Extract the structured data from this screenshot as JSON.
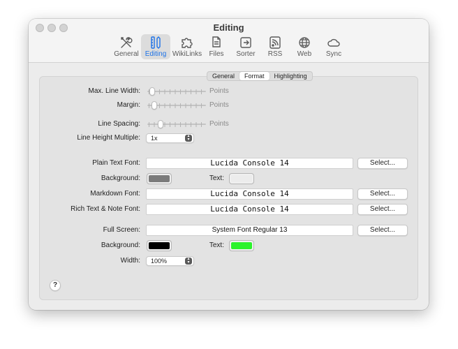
{
  "window": {
    "title": "Editing"
  },
  "toolbar": {
    "items": [
      {
        "label": "General",
        "icon": "tools-icon",
        "active": false
      },
      {
        "label": "Editing",
        "icon": "pencil-ruler-icon",
        "active": true
      },
      {
        "label": "WikiLinks",
        "icon": "puzzle-icon",
        "active": false
      },
      {
        "label": "Files",
        "icon": "files-icon",
        "active": false
      },
      {
        "label": "Sorter",
        "icon": "sorter-icon",
        "active": false
      },
      {
        "label": "RSS",
        "icon": "rss-icon",
        "active": false
      },
      {
        "label": "Web",
        "icon": "globe-icon",
        "active": false
      },
      {
        "label": "Sync",
        "icon": "cloud-icon",
        "active": false
      }
    ]
  },
  "tabs": [
    {
      "label": "General",
      "selected": false
    },
    {
      "label": "Format",
      "selected": true
    },
    {
      "label": "Highlighting",
      "selected": false
    }
  ],
  "format": {
    "max_line_width": {
      "label": "Max. Line Width:",
      "unit": "Points",
      "value_fraction": 0.05
    },
    "margin": {
      "label": "Margin:",
      "unit": "Points",
      "value_fraction": 0.08
    },
    "line_spacing": {
      "label": "Line Spacing:",
      "unit": "Points",
      "value_fraction": 0.22
    },
    "line_height_multiple": {
      "label": "Line Height Multiple:",
      "value": "1x"
    },
    "plain_text_font": {
      "label": "Plain Text Font:",
      "value": "Lucida Console 14",
      "button": "Select..."
    },
    "plain_colors": {
      "background_label": "Background:",
      "background_color": "#7b7b7b",
      "text_label": "Text:",
      "text_color": "#ececec"
    },
    "markdown_font": {
      "label": "Markdown Font:",
      "value": "Lucida Console 14",
      "button": "Select..."
    },
    "rich_text_font": {
      "label": "Rich Text & Note Font:",
      "value": "Lucida Console 14",
      "button": "Select..."
    },
    "full_screen": {
      "label": "Full Screen:",
      "value": "System Font Regular 13",
      "button": "Select..."
    },
    "full_screen_colors": {
      "background_label": "Background:",
      "background_color": "#000000",
      "text_label": "Text:",
      "text_color": "#2cf32c"
    },
    "width": {
      "label": "Width:",
      "value": "100%"
    }
  },
  "help": {
    "label": "?"
  }
}
